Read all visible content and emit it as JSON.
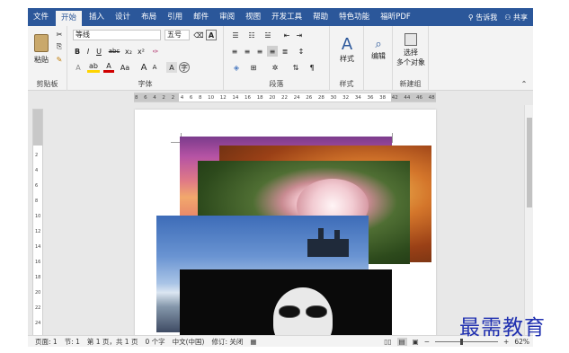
{
  "tabs": [
    "文件",
    "开始",
    "插入",
    "设计",
    "布局",
    "引用",
    "邮件",
    "审阅",
    "视图",
    "开发工具",
    "帮助",
    "特色功能",
    "福昕PDF"
  ],
  "active_tab": "开始",
  "tell_me": "告诉我",
  "share": "共享",
  "ribbon": {
    "paste": "粘贴",
    "clipboard": "剪贴板",
    "font_name": "等线",
    "font_size": "五号",
    "font_group": "字体",
    "paragraph_group": "段落",
    "styles_button": "样式",
    "styles_group": "样式",
    "editing_button": "编辑",
    "select_label": "选择",
    "select_sub": "多个对象",
    "new_group": "新建组",
    "bold": "B",
    "italic": "I",
    "underline": "U",
    "strikethrough": "abc",
    "subscript": "x₂",
    "superscript": "x²",
    "change_case": "Aa",
    "grow_font": "A",
    "shrink_font": "A"
  },
  "ruler": {
    "corner": "L",
    "ticks": [
      "8",
      "6",
      "4",
      "2",
      "2",
      "4",
      "6",
      "8",
      "10",
      "12",
      "14",
      "16",
      "18",
      "20",
      "22",
      "24",
      "26",
      "28",
      "30",
      "32",
      "34",
      "36",
      "38",
      "42",
      "44",
      "46",
      "48"
    ],
    "vticks": [
      "2",
      "4",
      "6",
      "8",
      "10",
      "12",
      "14",
      "16",
      "18",
      "20",
      "22",
      "24"
    ]
  },
  "status": {
    "page": "页面: 1",
    "section": "节: 1",
    "pages": "第 1 页，共 1 页",
    "words": "0 个字",
    "language": "中文(中国)",
    "track_changes": "修订: 关闭",
    "zoom": "62%",
    "zoom_minus": "−",
    "zoom_plus": "+"
  },
  "watermark": "最需教育",
  "colors": {
    "accent": "#2b579a",
    "ribbon_bg": "#f3f3f3",
    "watermark": "#2030b0"
  }
}
